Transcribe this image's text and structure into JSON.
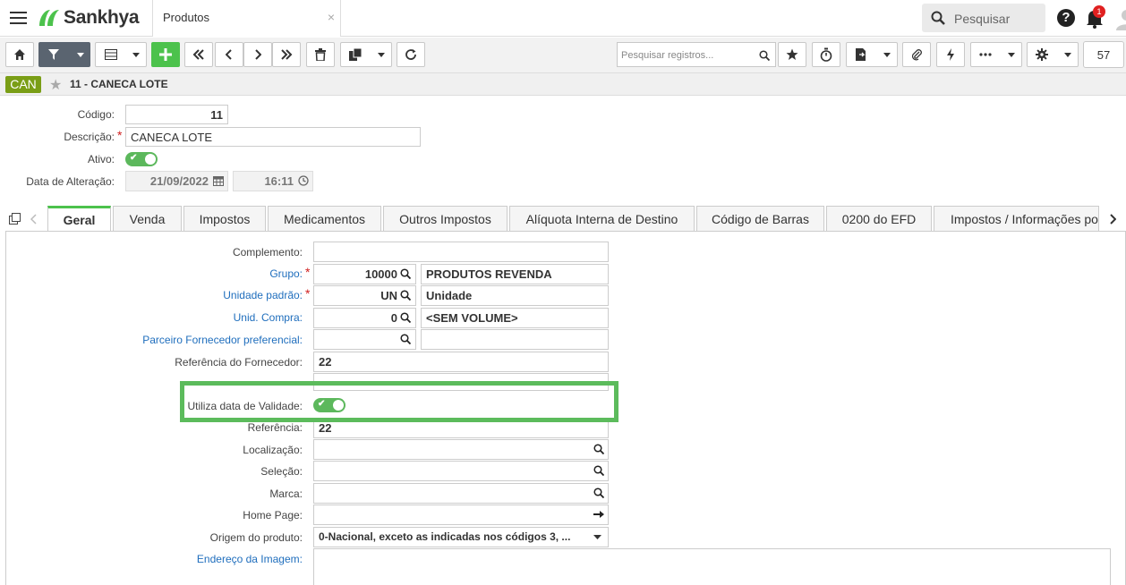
{
  "app": {
    "brand": "Sankhya",
    "tab_title": "Produtos",
    "tab_close": "×"
  },
  "top": {
    "search_placeholder": "Pesquisar",
    "notifications": "1",
    "help": "?"
  },
  "toolbar": {
    "search_records_placeholder": "Pesquisar registros...",
    "record_count": "57"
  },
  "record": {
    "badge": "CAN",
    "title": "11 - CANECA LOTE"
  },
  "header_fields": {
    "codigo_label": "Código:",
    "codigo_value": "11",
    "descricao_label": "Descrição:",
    "descricao_value": "CANECA LOTE",
    "ativo_label": "Ativo:",
    "data_label": "Data de Alteração:",
    "data_value": "21/09/2022",
    "hora_value": "16:11"
  },
  "tabs": [
    "Geral",
    "Venda",
    "Impostos",
    "Medicamentos",
    "Outros Impostos",
    "Alíquota Interna de Destino",
    "Código de Barras",
    "0200 do EFD",
    "Impostos / Informações po"
  ],
  "form": {
    "complemento_label": "Complemento:",
    "grupo_label": "Grupo:",
    "grupo_code": "10000",
    "grupo_desc": "PRODUTOS REVENDA",
    "unidade_label": "Unidade padrão:",
    "unidade_code": "UN",
    "unidade_desc": "Unidade",
    "unid_compra_label": "Unid. Compra:",
    "unid_compra_code": "0",
    "unid_compra_desc": "<SEM VOLUME>",
    "parceiro_label": "Parceiro Fornecedor preferencial:",
    "ref_forn_label": "Referência do Fornecedor:",
    "ref_forn_value": "22",
    "validade_label": "Utiliza data de Validade:",
    "referencia_label": "Referência:",
    "referencia_value": "22",
    "localizacao_label": "Localização:",
    "selecao_label": "Seleção:",
    "marca_label": "Marca:",
    "homepage_label": "Home Page:",
    "origem_label": "Origem do produto:",
    "origem_value": "0-Nacional, exceto as indicadas nos códigos 3, ...",
    "imagem_label": "Endereço da Imagem:"
  },
  "colors": {
    "accent": "#4cc24c",
    "badge": "#7a9e16",
    "link": "#1f6ebd",
    "highlight": "#5cbb5c"
  }
}
